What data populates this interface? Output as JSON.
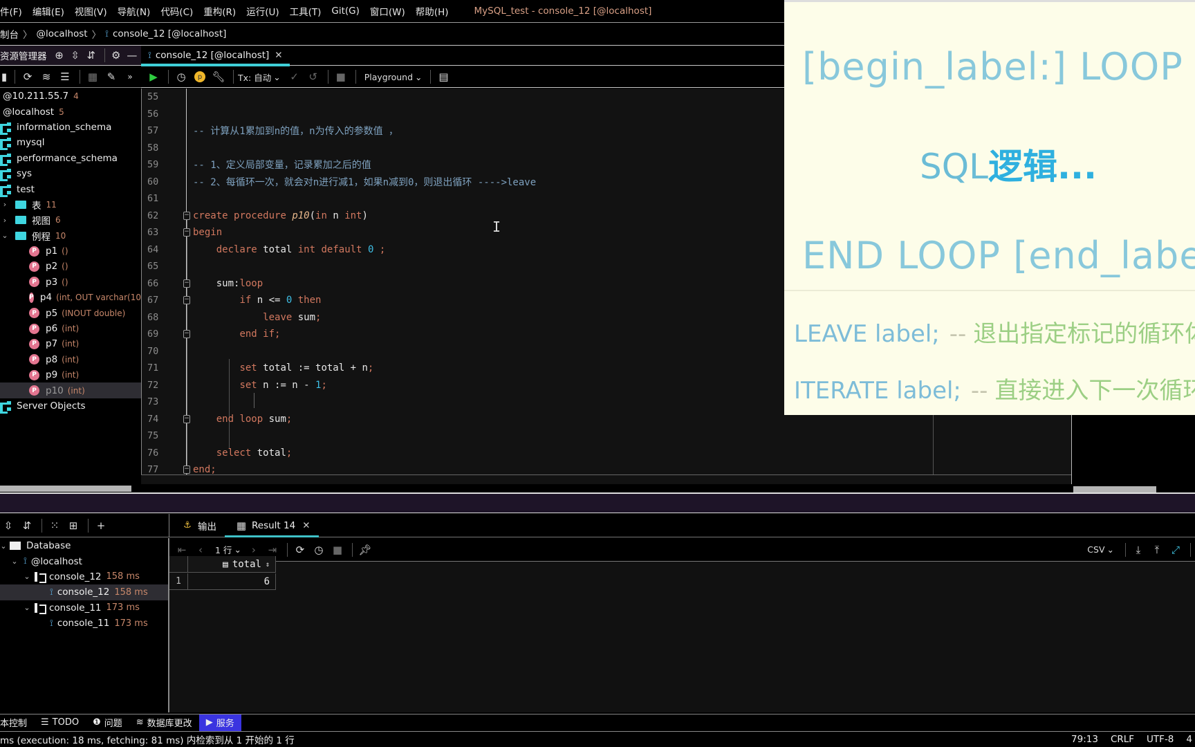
{
  "menubar": {
    "items": [
      "件(F)",
      "编辑(E)",
      "视图(V)",
      "导航(N)",
      "代码(C)",
      "重构(R)",
      "运行(U)",
      "工具(T)",
      "Git(G)",
      "窗口(W)",
      "帮助(H)"
    ],
    "window_title": "MySQL_test - console_12 [@localhost]"
  },
  "breadcrumb": {
    "items": [
      "制台",
      "@localhost",
      "console_12 [@localhost]"
    ]
  },
  "project_panel": {
    "title": "资源管理器",
    "tree": {
      "hosts": [
        {
          "label": "@10.211.55.7",
          "count": "4"
        },
        {
          "label": "@localhost",
          "count": "5"
        }
      ],
      "schemas": [
        "information_schema",
        "mysql",
        "performance_schema",
        "sys",
        "test"
      ],
      "folders": [
        {
          "label": "表",
          "count": "11",
          "expanded": false
        },
        {
          "label": "视图",
          "count": "6",
          "expanded": false
        },
        {
          "label": "例程",
          "count": "10",
          "expanded": true
        }
      ],
      "routines": [
        {
          "name": "p1",
          "sig": "()"
        },
        {
          "name": "p2",
          "sig": "()"
        },
        {
          "name": "p3",
          "sig": "()"
        },
        {
          "name": "p4",
          "sig": "(int, OUT varchar(10"
        },
        {
          "name": "p5",
          "sig": "(INOUT double)"
        },
        {
          "name": "p6",
          "sig": "(int)"
        },
        {
          "name": "p7",
          "sig": "(int)"
        },
        {
          "name": "p8",
          "sig": "(int)"
        },
        {
          "name": "p9",
          "sig": "(int)"
        },
        {
          "name": "p10",
          "sig": "(int)",
          "selected": true
        }
      ],
      "server_objects": "Server Objects"
    }
  },
  "editor": {
    "tab_label": "console_12 [@localhost]",
    "toolbar": {
      "tx_mode": "Tx: 自动",
      "playground": "Playground"
    },
    "lines": [
      {
        "n": "55",
        "text": ""
      },
      {
        "n": "56",
        "text": ""
      },
      {
        "n": "57",
        "text": "-- 计算从1累加到n的值，n为传入的参数值 ，"
      },
      {
        "n": "58",
        "text": ""
      },
      {
        "n": "59",
        "text": "-- 1、定义局部变量，记录累加之后的值"
      },
      {
        "n": "60",
        "text": "-- 2、每循环一次，就会对n进行减1，如果n减到0，则退出循环 ---->leave"
      },
      {
        "n": "61",
        "text": ""
      },
      {
        "n": "62",
        "text": "create procedure p10(in n int)"
      },
      {
        "n": "63",
        "text": "begin"
      },
      {
        "n": "64",
        "text": "    declare total int default 0 ;"
      },
      {
        "n": "65",
        "text": ""
      },
      {
        "n": "66",
        "text": "    sum:loop"
      },
      {
        "n": "67",
        "text": "        if n <= 0 then"
      },
      {
        "n": "68",
        "text": "            leave sum;"
      },
      {
        "n": "69",
        "text": "        end if;"
      },
      {
        "n": "70",
        "text": ""
      },
      {
        "n": "71",
        "text": "        set total := total + n;"
      },
      {
        "n": "72",
        "text": "        set n := n - 1;"
      },
      {
        "n": "73",
        "text": ""
      },
      {
        "n": "74",
        "text": "    end loop sum;"
      },
      {
        "n": "75",
        "text": ""
      },
      {
        "n": "76",
        "text": "    select total;"
      },
      {
        "n": "77",
        "text": "end;"
      }
    ]
  },
  "overlay": {
    "line1": "[begin_label:] LOOP",
    "line2_prefix": "SQL",
    "line2_bold": "逻辑...",
    "line3": "END LOOP [end_label",
    "leave_code": "LEAVE label;",
    "leave_comment": "退出指定标记的循环体",
    "iterate_code": "ITERATE label;",
    "iterate_comment": "直接进入下一次循环"
  },
  "services": {
    "tree": {
      "root": "Database",
      "host": "@localhost",
      "sessions": [
        {
          "label": "console_12",
          "time": "158 ms",
          "child": "console_12",
          "child_time": "158 ms",
          "child_selected": true
        },
        {
          "label": "console_11",
          "time": "173 ms",
          "child": "console_11",
          "child_time": "173 ms"
        }
      ]
    }
  },
  "results": {
    "tabs": [
      {
        "label": "输出",
        "active": false
      },
      {
        "label": "Result 14",
        "active": true
      }
    ],
    "rows_selector": "1 行",
    "export_format": "CSV",
    "columns": [
      "total"
    ],
    "rows": [
      [
        "1",
        "6"
      ]
    ]
  },
  "bottom_tabs": [
    {
      "label": "本控制",
      "icon": ""
    },
    {
      "label": "TODO",
      "icon": "list-icon"
    },
    {
      "label": "问题",
      "icon": "problem-icon"
    },
    {
      "label": "数据库更改",
      "icon": "db-changes-icon"
    },
    {
      "label": "服务",
      "icon": "services-icon",
      "active": true
    }
  ],
  "statusbar": {
    "message": "ms (execution: 18 ms, fetching: 81 ms) 内检索到从 1 开始的 1 行",
    "position": "79:13",
    "line_ending": "CRLF",
    "encoding": "UTF-8",
    "indent": "4"
  }
}
